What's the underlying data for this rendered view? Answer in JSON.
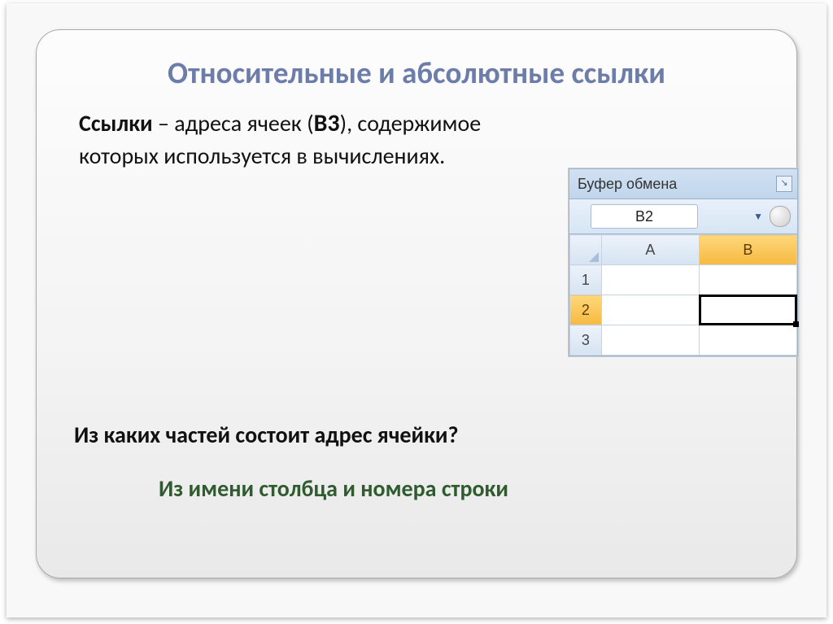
{
  "slide": {
    "title": "Относительные и абсолютные ссылки",
    "body_term": "Ссылки",
    "body_mid1": " – адреса ячеек (",
    "body_cellref": "В3",
    "body_mid2": "), содержимое",
    "body_line2": "которых используется в вычислениях.",
    "question": "Из каких частей состоит адрес ячейки?",
    "answer": "Из имени столбца и номера строки"
  },
  "excel": {
    "ribbon_group": "Буфер обмена",
    "launcher_glyph": "↘",
    "namebox_value": "B2",
    "col_a": "A",
    "col_b": "B",
    "row_1": "1",
    "row_2": "2",
    "row_3": "3"
  }
}
